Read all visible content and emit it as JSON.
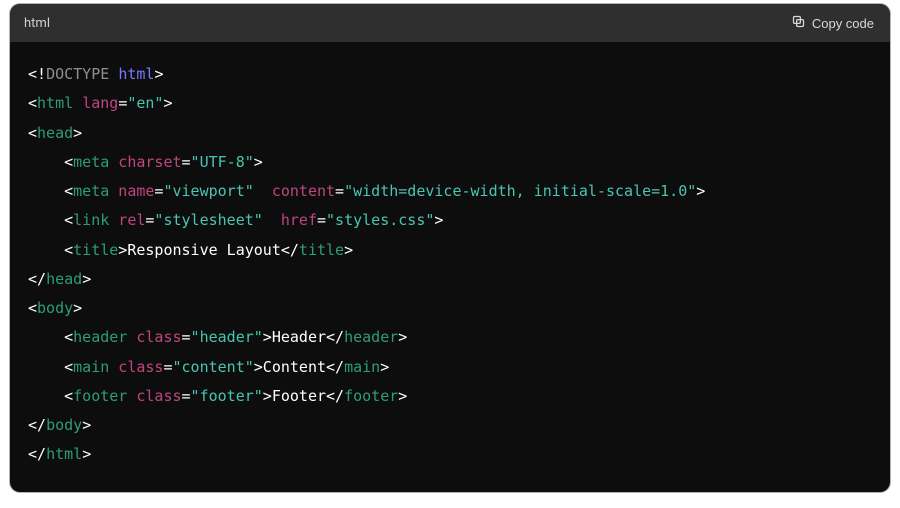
{
  "header": {
    "language_label": "html",
    "copy_label": "Copy code"
  },
  "code": {
    "doctype_prefix": "<!",
    "doctype_word": "DOCTYPE",
    "doctype_kw": "html",
    "doctype_suffix": ">",
    "html_open": "html",
    "lang_attr": "lang",
    "lang_val": "\"en\"",
    "head_tag": "head",
    "meta_tag": "meta",
    "charset_attr": "charset",
    "charset_val": "\"UTF-8\"",
    "name_attr": "name",
    "viewport_val": "\"viewport\"",
    "content_attr": "content",
    "content_val": "\"width=device-width, initial-scale=1.0\"",
    "link_tag": "link",
    "rel_attr": "rel",
    "rel_val": "\"stylesheet\"",
    "href_attr": "href",
    "href_val": "\"styles.css\"",
    "title_tag": "title",
    "title_text": "Responsive Layout",
    "body_tag": "body",
    "header_tag": "header",
    "class_attr": "class",
    "header_class_val": "\"header\"",
    "header_text": "Header",
    "main_tag": "main",
    "main_class_val": "\"content\"",
    "main_text": "Content",
    "footer_tag": "footer",
    "footer_class_val": "\"footer\"",
    "footer_text": "Footer"
  }
}
